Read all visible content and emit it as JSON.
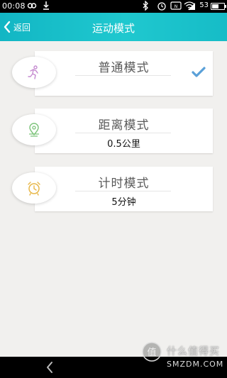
{
  "status_bar": {
    "time": "00:08",
    "battery": "53",
    "icons": [
      "infinity-icon",
      "download-icon",
      "bluetooth-icon",
      "alarm-icon",
      "nfc-icon",
      "wifi-icon",
      "signal-icon",
      "signal-icon",
      "battery-icon"
    ]
  },
  "header": {
    "back_label": "返回",
    "title": "运动模式",
    "bg_color": "#1cc3cc"
  },
  "modes": [
    {
      "title": "普通模式",
      "value": "",
      "icon": "running-person-icon",
      "selected": true
    },
    {
      "title": "距离模式",
      "value": "0.5公里",
      "icon": "location-pin-icon",
      "selected": false
    },
    {
      "title": "计时模式",
      "value": "5分钟",
      "icon": "alarm-clock-icon",
      "selected": false
    }
  ],
  "accent": {
    "check": "#5aa0d8",
    "run_icon": "#c58ad0",
    "pin_icon": "#7cc47a",
    "clock_icon": "#e8b84a"
  },
  "watermark": {
    "cn": "什么值得买",
    "en": "SMZDM.COM"
  }
}
